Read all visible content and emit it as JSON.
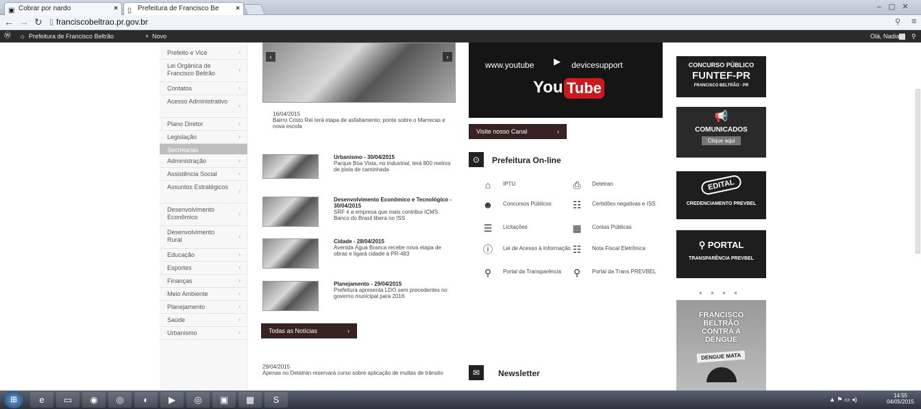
{
  "browser": {
    "tabs": [
      {
        "label": "Cobrar por nardo",
        "icon": "▣"
      },
      {
        "label": "Prefeitura de Francisco Be",
        "icon": "▯"
      }
    ],
    "url": "franciscobeltrao.pr.gov.br",
    "bookmarks": [
      {
        "label": "Prefeitura de Francisco Beltrão"
      },
      {
        "label": "Novo"
      }
    ],
    "user": "Olá, Nadia"
  },
  "sidebar": {
    "items": [
      {
        "label": "Prefeito e Vice"
      },
      {
        "label": "Lei Orgânica de Francisco Beltrão"
      },
      {
        "label": "Contatos"
      },
      {
        "label": "Acesso Administrativo"
      },
      {
        "label": "Plano Diretor"
      },
      {
        "label": "Legislação"
      },
      {
        "label": "Secretarias"
      },
      {
        "label": "Administração"
      },
      {
        "label": "Assistência Social"
      },
      {
        "label": "Assuntos Estratégicos"
      },
      {
        "label": "Desenvolvimento Econômico"
      },
      {
        "label": "Desenvolvimento Rural"
      },
      {
        "label": "Educação"
      },
      {
        "label": "Esportes"
      },
      {
        "label": "Finanças"
      },
      {
        "label": "Meio Ambiente"
      },
      {
        "label": "Planejamento"
      },
      {
        "label": "Saúde"
      },
      {
        "label": "Urbanismo"
      }
    ]
  },
  "featured": {
    "date": "16/04/2015",
    "text": "Bairro Cristo Rei terá etapa de asfaltamento: ponte sobre o Marrecas e nova escola"
  },
  "news": [
    {
      "title": "Urbanismo - 30/04/2015",
      "text": "Parque Boa Vista, no Industrial, terá 800 metros de pista de caminhada"
    },
    {
      "title": "Desenvolvimento Econômico e Tecnológico - 30/04/2015",
      "text": "SRF é a empresa que mais contribui ICMS. Banco do Brasil libera no ISS"
    },
    {
      "title": "Cidade - 28/04/2015",
      "text": "Avenida Água Branca recebe nova etapa de obras e ligará cidade à PR-483"
    },
    {
      "title": "Planejamento - 29/04/2015",
      "text": "Prefeitura apresenta LDO sem precedentes no governo municipal para 2016"
    }
  ],
  "all_news_button": "Todas as Notícias",
  "bottom_news": {
    "date": "29/04/2015",
    "text": "Apenas no Detatran reservará curso sobre aplicação de multas de trânsito"
  },
  "youtube": {
    "url_left": "www.youtube",
    "url_right": "devicesupport",
    "logo_you": "You",
    "logo_tube": "Tube",
    "button": "Visite nosso Canal"
  },
  "online": {
    "title": "Prefeitura On-line",
    "items": [
      {
        "label": "IPTU",
        "icon": "house-icon",
        "glyph": "⌂"
      },
      {
        "label": "Detetran",
        "icon": "car-icon",
        "glyph": "⎙"
      },
      {
        "label": "Concursos Públicos",
        "icon": "person-icon",
        "glyph": "☻"
      },
      {
        "label": "Certidões negativas e ISS",
        "icon": "document-icon",
        "glyph": "☷"
      },
      {
        "label": "Licitações",
        "icon": "list-icon",
        "glyph": "☰"
      },
      {
        "label": "Contas Públicas",
        "icon": "calculator-icon",
        "glyph": "▦"
      },
      {
        "label": "Lei de Acesso à Informação",
        "icon": "info-icon",
        "glyph": "ⓘ"
      },
      {
        "label": "Nota Fiscal Eletrônica",
        "icon": "receipt-icon",
        "glyph": "☷"
      },
      {
        "label": "Portal da Transparência",
        "icon": "magnifier-icon",
        "glyph": "⚲"
      },
      {
        "label": "Portal da Trans PREVBEL",
        "icon": "search-person-icon",
        "glyph": "⚲"
      }
    ]
  },
  "newsletter": {
    "title": "Newsletter"
  },
  "banners": {
    "concurso": {
      "line1": "CONCURSO PÚBLICO",
      "line2": "FUNTEF-PR",
      "line3": "FRANCISCO BELTRÃO - PR"
    },
    "comunicados": {
      "title": "COMUNICADOS",
      "button": "Clique aqui"
    },
    "edital": {
      "stamp": "EDITAL",
      "caption": "CREDENCIAMENTO PREVBEL"
    },
    "portal": {
      "title": "PORTAL",
      "caption": "TRANSPARÊNCIA PREVBEL"
    },
    "dengue": {
      "line1": "FRANCISCO",
      "line2": "BELTRÃO",
      "line3": "CONTRA A",
      "line4": "DENGUE",
      "tag": "DENGUE MATA"
    }
  },
  "taskbar": {
    "time": "14:55",
    "date": "04/05/2015"
  },
  "colors": {
    "youtube_red": "#cc181e",
    "banner_dark": "#2a2a2a",
    "button_dark": "#3a2222"
  }
}
